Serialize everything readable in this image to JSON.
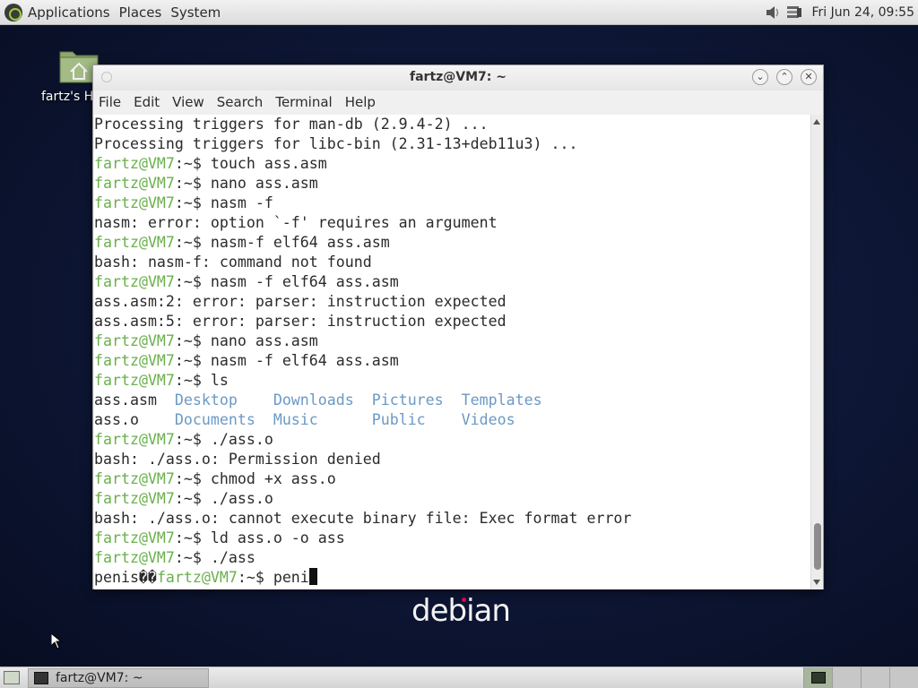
{
  "top_panel": {
    "menus": [
      "Applications",
      "Places",
      "System"
    ],
    "clock": "Fri Jun 24, 09:55"
  },
  "desktop": {
    "home_label": "fartz's H",
    "logo_text": "debian"
  },
  "window": {
    "title": "fartz@VM7: ~",
    "menus": [
      "File",
      "Edit",
      "View",
      "Search",
      "Terminal",
      "Help"
    ]
  },
  "terminal": {
    "prompt": "fartz@VM7",
    "lines": [
      {
        "text": "Processing triggers for man-db (2.9.4-2) ..."
      },
      {
        "text": "Processing triggers for libc-bin (2.31-13+deb11u3) ..."
      },
      {
        "cmd": "touch ass.asm"
      },
      {
        "cmd": "nano ass.asm"
      },
      {
        "cmd": "nasm -f"
      },
      {
        "text": "nasm: error: option `-f' requires an argument"
      },
      {
        "cmd": "nasm-f elf64 ass.asm"
      },
      {
        "text": "bash: nasm-f: command not found"
      },
      {
        "cmd": "nasm -f elf64 ass.asm"
      },
      {
        "text": "ass.asm:2: error: parser: instruction expected"
      },
      {
        "text": "ass.asm:5: error: parser: instruction expected"
      },
      {
        "cmd": "nano ass.asm"
      },
      {
        "cmd": "nasm -f elf64 ass.asm"
      },
      {
        "cmd": "ls"
      },
      {
        "ls": [
          "ass.asm",
          "Desktop",
          "Downloads",
          "Pictures",
          "Templates"
        ]
      },
      {
        "ls": [
          "ass.o",
          "Documents",
          "Music",
          "Public",
          "Videos"
        ]
      },
      {
        "cmd": "./ass.o"
      },
      {
        "text": "bash: ./ass.o: Permission denied"
      },
      {
        "cmd": "chmod +x ass.o"
      },
      {
        "cmd": "./ass.o"
      },
      {
        "text": "bash: ./ass.o: cannot execute binary file: Exec format error"
      },
      {
        "cmd": "ld ass.o -o ass"
      },
      {
        "cmd": "./ass"
      },
      {
        "pre": "penis��",
        "cmd": "peni",
        "current": true
      }
    ]
  },
  "taskbar": {
    "task_label": "fartz@VM7: ~"
  }
}
